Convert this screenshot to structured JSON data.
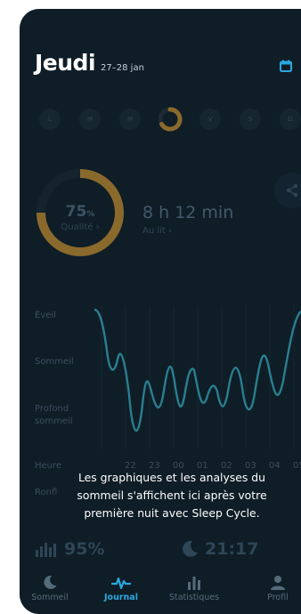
{
  "header": {
    "day": "Jeudi",
    "date": "27–28 jan",
    "calendar_icon": "calendar-icon"
  },
  "weekdays": [
    "L",
    "M",
    "M",
    "J",
    "V",
    "S",
    "D"
  ],
  "summary": {
    "quality_number": "75",
    "quality_unit": "%",
    "quality_label": "Qualité ›",
    "quality_fraction": 0.75,
    "duration": "8 h 12 min",
    "in_bed_label": "Au lit ›",
    "share_icon": "share-icon"
  },
  "graph": {
    "y_labels": {
      "awake": "Éveil",
      "sleep": "Sommeil",
      "deep_line1": "Profond",
      "deep_line2": "sommeil"
    },
    "hours_label": "Heure",
    "hours": [
      "22",
      "23",
      "00",
      "01",
      "02",
      "03",
      "04",
      "05"
    ],
    "snoring_label": "Ronfl"
  },
  "message": {
    "line1": "Les graphiques et les analyses du",
    "line2": "sommeil s'affichent ici après votre",
    "line3": "première nuit avec Sleep Cycle."
  },
  "stats": {
    "regularity": "95%",
    "bedtime": "21:17"
  },
  "tabs": [
    {
      "label": "Sommeil",
      "icon": "moon-icon"
    },
    {
      "label": "Journal",
      "icon": "pulse-icon"
    },
    {
      "label": "Statistiques",
      "icon": "bar-chart-icon"
    },
    {
      "label": "Profil",
      "icon": "person-icon"
    }
  ],
  "colors": {
    "background": "#0f1d27",
    "accent": "#2aa8e0",
    "quality_ring": "#8a6a2c",
    "graph_line": "#2a7f8f"
  }
}
